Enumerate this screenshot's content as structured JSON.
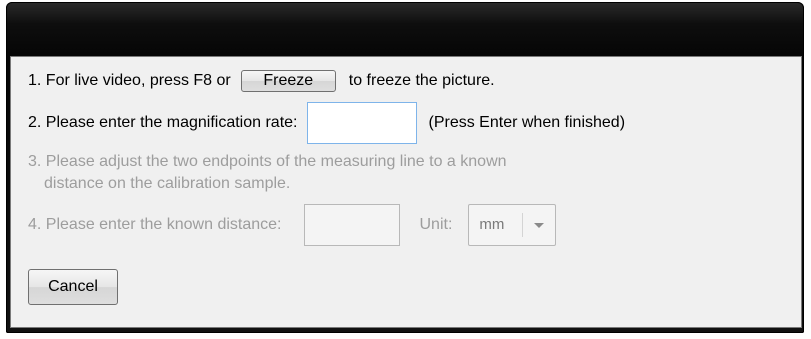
{
  "step1": {
    "prefix": "1. For live video, press F8 or",
    "freeze_button": "Freeze",
    "suffix": "to freeze the picture."
  },
  "step2": {
    "label": "2. Please enter the magnification rate:",
    "value": "",
    "hint": "(Press Enter when finished)"
  },
  "step3": {
    "line1": "3. Please adjust the two endpoints of the measuring line to a known",
    "line2": "distance on the calibration sample."
  },
  "step4": {
    "label": "4. Please enter the known distance:",
    "value": "",
    "unit_label": "Unit:",
    "unit_selected": "mm"
  },
  "cancel_button": "Cancel",
  "colors": {
    "title_bar": "#0e0e0e",
    "panel_bg": "#f0f0f0",
    "disabled_text": "#9d9d9d",
    "active_input_border": "#7eb4ea"
  }
}
